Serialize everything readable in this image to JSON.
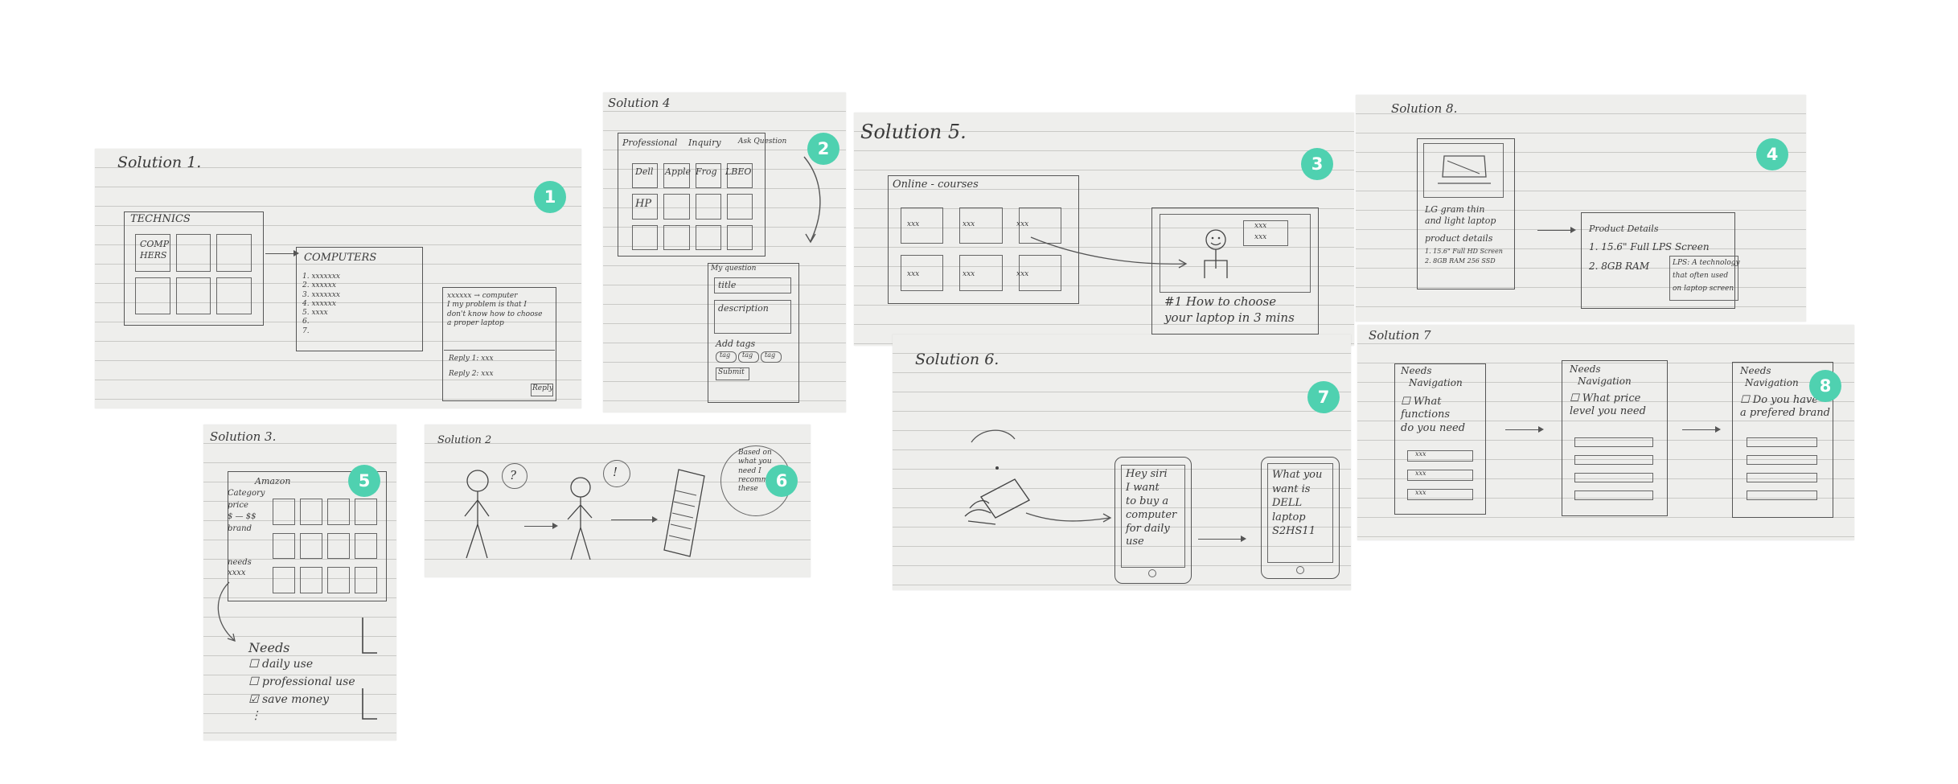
{
  "sheets": {
    "s1": {
      "title": "Solution 1.",
      "technics": "TECHNICS",
      "comp": "COMP",
      "hers": "HERS",
      "computers": "COMPUTERS",
      "list": [
        "1. xxxxxxx",
        "2. xxxxxx",
        "3. xxxxxxx",
        "4. xxxxxx",
        "5. xxxx",
        "6.",
        "7."
      ],
      "post": [
        "xxxxxx → computer",
        "I my problem is that I",
        "don't know how to choose",
        "a proper laptop"
      ],
      "replies": [
        "Reply 1: xxx",
        "Reply 2: xxx"
      ],
      "reply_btn": "Reply"
    },
    "s4": {
      "title": "Solution 4",
      "tabs": [
        "Professional",
        "Inquiry",
        "Ask Question"
      ],
      "brands": [
        "Dell",
        "Apple",
        "Frog",
        "LBEO",
        "HP"
      ],
      "form": [
        "My question",
        "title",
        "description",
        "Add tags"
      ],
      "tags": [
        "tag",
        "tag",
        "tag"
      ],
      "submit": "Submit"
    },
    "s5": {
      "title": "Solution 5.",
      "courses": "Online - courses",
      "tiles": [
        "xxx",
        "xxx",
        "xxx",
        "xxx",
        "xxx",
        "xxx"
      ],
      "video_tags": [
        "xxx",
        "xxx"
      ],
      "caption": [
        "#1 How to choose",
        "your laptop in 3 mins"
      ]
    },
    "s8": {
      "title": "Solution 8.",
      "product": [
        "LG gram thin",
        "and light laptop"
      ],
      "details_label": "product details",
      "details": [
        "1. 15.6\" Full HD Screen",
        "2. 8GB RAM 256 SSD"
      ],
      "panel_title": "Product Details",
      "panel_lines": [
        "1. 15.6\" Full LPS Screen",
        "2. 8GB RAM"
      ],
      "tooltip": [
        "LPS: A technology",
        "that often used",
        "on laptop screen"
      ]
    },
    "s3": {
      "title": "Solution 3.",
      "store": "Amazon",
      "filters": [
        "Category",
        "price",
        "$ — $$",
        "brand",
        "needs",
        "xxxx"
      ],
      "needs_title": "Needs",
      "needs": [
        "☐ daily use",
        "☐ professional use",
        "☑ save money",
        "⋮"
      ]
    },
    "s2": {
      "title": "Solution 2",
      "bubble": "?",
      "bubble2": "!",
      "callout": [
        "Based on",
        "what you",
        "need I",
        "recommend",
        "these"
      ]
    },
    "s6": {
      "title": "Solution 6.",
      "phone1": [
        "Hey siri",
        "I want",
        "to buy a",
        "computer",
        "for daily",
        "use"
      ],
      "phone2": [
        "What you",
        "want is",
        "DELL",
        "laptop",
        "S2HS11"
      ]
    },
    "s7": {
      "title": "Solution 7",
      "panel1": [
        "Needs",
        "Navigation",
        "☐ What",
        "functions",
        "do you need"
      ],
      "panel1_items": [
        "xxx",
        "xxx",
        "xxx"
      ],
      "panel2": [
        "Needs",
        "Navigation",
        "☐ What price",
        "level you need"
      ],
      "panel3": [
        "Needs",
        "Navigation",
        "☐ Do you have",
        "a prefered brand"
      ]
    }
  },
  "badges": [
    "1",
    "2",
    "3",
    "4",
    "5",
    "6",
    "7",
    "8"
  ],
  "badge_color": "#4fd1b0"
}
